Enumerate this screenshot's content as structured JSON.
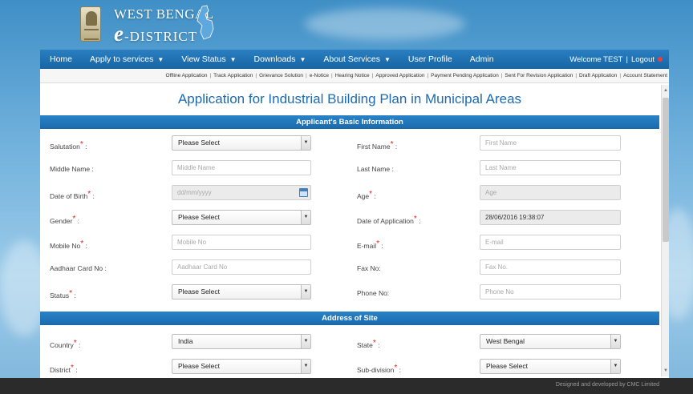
{
  "brand": {
    "line1": "WEST BENGAL",
    "line2_e": "e",
    "line2_rest": "-DISTRICT"
  },
  "nav": {
    "items": [
      {
        "label": "Home",
        "dropdown": false
      },
      {
        "label": "Apply to services",
        "dropdown": true
      },
      {
        "label": "View Status",
        "dropdown": true
      },
      {
        "label": "Downloads",
        "dropdown": true
      },
      {
        "label": "About Services",
        "dropdown": true
      },
      {
        "label": "User Profile",
        "dropdown": false
      },
      {
        "label": "Admin",
        "dropdown": false
      }
    ],
    "welcome": "Welcome TEST",
    "logout": "Logout"
  },
  "subnav": {
    "links": [
      "Offline Application",
      "Track Application",
      "Grievance Solution",
      "e-Notice",
      "Hearing Notice",
      "Approved Application",
      "Payment Pending Application",
      "Sent For Revision Application",
      "Draft Application",
      "Account Statement"
    ]
  },
  "page": {
    "title": "Application for Industrial Building Plan in Municipal Areas"
  },
  "sections": {
    "basic": "Applicant's Basic Information",
    "address": "Address of Site"
  },
  "form": {
    "salutation": {
      "label": "Salutation",
      "value": "Please Select"
    },
    "first_name": {
      "label": "First Name",
      "placeholder": "First Name"
    },
    "middle_name": {
      "label": "Middle Name :",
      "placeholder": "Middle Name"
    },
    "last_name": {
      "label": "Last Name :",
      "placeholder": "Last Name"
    },
    "dob": {
      "label": "Date of Birth",
      "placeholder": "dd/mm/yyyy"
    },
    "age": {
      "label": "Age",
      "placeholder": "Age"
    },
    "gender": {
      "label": "Gender",
      "value": "Please Select"
    },
    "date_of_application": {
      "label": "Date of Application",
      "value": "28/06/2016 19:38:07"
    },
    "mobile": {
      "label": "Mobile No",
      "placeholder": "Mobile No"
    },
    "email": {
      "label": "E-mail",
      "placeholder": "E-mail"
    },
    "aadhaar": {
      "label": "Aadhaar Card No :",
      "placeholder": "Aadhaar Card No"
    },
    "fax": {
      "label": "Fax No:",
      "placeholder": "Fax No."
    },
    "status": {
      "label": "Status",
      "value": "Please Select"
    },
    "phone": {
      "label": "Phone No:",
      "placeholder": "Phone No"
    },
    "country": {
      "label": "Country",
      "value": "India"
    },
    "state": {
      "label": "State",
      "value": "West Bengal"
    },
    "district": {
      "label": "District",
      "value": "Please Select"
    },
    "subdivision": {
      "label": "Sub-division",
      "value": "Please Select"
    }
  },
  "footer": {
    "text": "Designed and developed by CMC Limited"
  },
  "colors": {
    "primary": "#1d6ab1",
    "nav_bg": "#1765a5",
    "required": "#e02020"
  }
}
